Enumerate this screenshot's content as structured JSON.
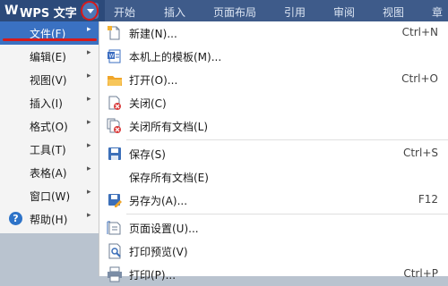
{
  "app": {
    "logo": "W",
    "title": "WPS 文字"
  },
  "tabs": [
    "开始",
    "插入",
    "页面布局",
    "引用",
    "审阅",
    "视图",
    "章"
  ],
  "left_menu": [
    {
      "label": "文件(F)",
      "selected": true
    },
    {
      "label": "编辑(E)"
    },
    {
      "label": "视图(V)"
    },
    {
      "label": "插入(I)"
    },
    {
      "label": "格式(O)"
    },
    {
      "label": "工具(T)"
    },
    {
      "label": "表格(A)"
    },
    {
      "label": "窗口(W)"
    },
    {
      "label": "帮助(H)",
      "icon": "help-icon"
    }
  ],
  "file_menu": {
    "new": {
      "label": "新建(N)...",
      "shortcut": "Ctrl+N"
    },
    "templates": {
      "label": "本机上的模板(M)..."
    },
    "open": {
      "label": "打开(O)...",
      "shortcut": "Ctrl+O"
    },
    "close": {
      "label": "关闭(C)"
    },
    "close_all": {
      "label": "关闭所有文档(L)"
    },
    "save": {
      "label": "保存(S)",
      "shortcut": "Ctrl+S"
    },
    "save_all": {
      "label": "保存所有文档(E)"
    },
    "save_as": {
      "label": "另存为(A)...",
      "shortcut": "F12"
    },
    "page_setup": {
      "label": "页面设置(U)..."
    },
    "print_preview": {
      "label": "打印预览(V)"
    },
    "print": {
      "label": "打印(P)...",
      "shortcut": "Ctrl+P"
    }
  },
  "colors": {
    "accent": "#3a71c2",
    "annotation": "#d61a1a"
  }
}
